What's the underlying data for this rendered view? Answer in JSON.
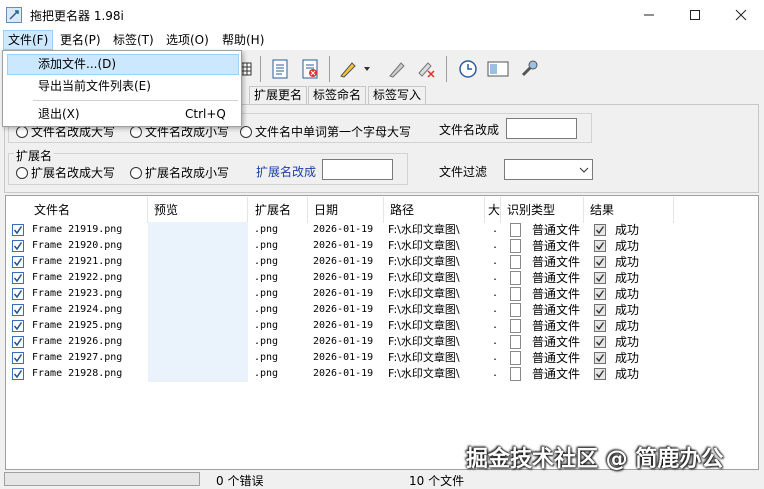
{
  "window": {
    "title": "拖把更名器 1.98i",
    "minimize_icon": "minimize-icon",
    "maximize_icon": "maximize-icon",
    "close_icon": "close-icon"
  },
  "menubar": {
    "items": [
      {
        "label": "文件(F)"
      },
      {
        "label": "更名(P)"
      },
      {
        "label": "标签(T)"
      },
      {
        "label": "选项(O)"
      },
      {
        "label": "帮助(H)"
      }
    ]
  },
  "file_menu": {
    "items": [
      {
        "label": "添加文件...(D)",
        "shortcut": ""
      },
      {
        "label": "导出当前文件列表(E)",
        "shortcut": ""
      },
      {
        "label": "退出(X)",
        "shortcut": "Ctrl+Q"
      }
    ]
  },
  "tabs": [
    {
      "label": "扩展更名"
    },
    {
      "label": "标签命名"
    },
    {
      "label": "标签写入"
    }
  ],
  "options": {
    "filename_upper": "文件名改成大写",
    "filename_lower": "文件名改成小写",
    "filename_capitalize": "文件名中单词第一个字母大写",
    "filename_change_to": "文件名改成",
    "extension_group": "扩展名",
    "ext_upper": "扩展名改成大写",
    "ext_lower": "扩展名改成小写",
    "ext_change_to": "扩展名改成",
    "file_filter": "文件过滤"
  },
  "list": {
    "columns": [
      {
        "label": "文件名"
      },
      {
        "label": "预览"
      },
      {
        "label": "扩展名"
      },
      {
        "label": "日期"
      },
      {
        "label": "路径"
      },
      {
        "label": "大"
      },
      {
        "label": "识别类型"
      },
      {
        "label": "结果"
      }
    ],
    "rows": [
      {
        "name": "Frame 21919.png",
        "ext": ".png",
        "date": "2026-01-19",
        "path": "F:\\水印文章图\\",
        "size": ".",
        "type": "普通文件",
        "result": "成功"
      },
      {
        "name": "Frame 21920.png",
        "ext": ".png",
        "date": "2026-01-19",
        "path": "F:\\水印文章图\\",
        "size": ".",
        "type": "普通文件",
        "result": "成功"
      },
      {
        "name": "Frame 21921.png",
        "ext": ".png",
        "date": "2026-01-19",
        "path": "F:\\水印文章图\\",
        "size": ".",
        "type": "普通文件",
        "result": "成功"
      },
      {
        "name": "Frame 21922.png",
        "ext": ".png",
        "date": "2026-01-19",
        "path": "F:\\水印文章图\\",
        "size": ".",
        "type": "普通文件",
        "result": "成功"
      },
      {
        "name": "Frame 21923.png",
        "ext": ".png",
        "date": "2026-01-19",
        "path": "F:\\水印文章图\\",
        "size": ".",
        "type": "普通文件",
        "result": "成功"
      },
      {
        "name": "Frame 21924.png",
        "ext": ".png",
        "date": "2026-01-19",
        "path": "F:\\水印文章图\\",
        "size": ".",
        "type": "普通文件",
        "result": "成功"
      },
      {
        "name": "Frame 21925.png",
        "ext": ".png",
        "date": "2026-01-19",
        "path": "F:\\水印文章图\\",
        "size": ".",
        "type": "普通文件",
        "result": "成功"
      },
      {
        "name": "Frame 21926.png",
        "ext": ".png",
        "date": "2026-01-19",
        "path": "F:\\水印文章图\\",
        "size": ".",
        "type": "普通文件",
        "result": "成功"
      },
      {
        "name": "Frame 21927.png",
        "ext": ".png",
        "date": "2026-01-19",
        "path": "F:\\水印文章图\\",
        "size": ".",
        "type": "普通文件",
        "result": "成功"
      },
      {
        "name": "Frame 21928.png",
        "ext": ".png",
        "date": "2026-01-19",
        "path": "F:\\水印文章图\\",
        "size": ".",
        "type": "普通文件",
        "result": "成功"
      }
    ]
  },
  "status": {
    "errors": "0 个错误",
    "files": "10 个文件"
  },
  "watermark": "掘金技术社区 @ 简鹿办公",
  "colors": {
    "menu_highlight": "#cce8ff",
    "blue_label": "#1a3fa8",
    "preview_bg": "#eaf2fb"
  }
}
